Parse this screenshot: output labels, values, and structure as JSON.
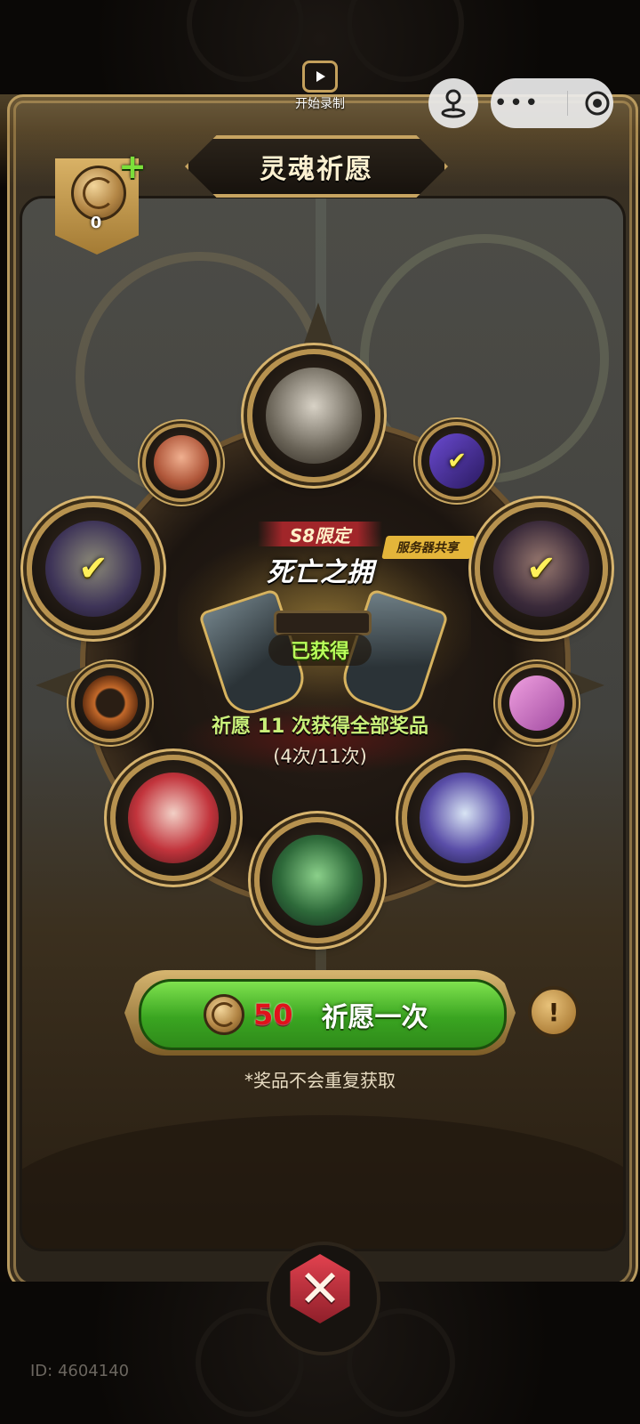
{
  "header": {
    "record_label": "开始录制",
    "title": "灵魂祈愿"
  },
  "currency": {
    "amount": "0",
    "add_icon": "plus-icon",
    "coin_icon": "soul-coin-icon"
  },
  "featured": {
    "season_tag": "S8限定",
    "name": "死亡之拥",
    "server_tag": "服务器共享",
    "status": "已获得"
  },
  "wish": {
    "info_text": "祈愿 11 次获得全部奖品",
    "progress": "(4次/11次)",
    "cost": "50",
    "button_label": "祈愿一次",
    "note": "*奖品不会重复获取",
    "info_button": "!"
  },
  "rewards": [
    {
      "slot": "top",
      "type": "hero-portrait",
      "obtained": false
    },
    {
      "slot": "top-left",
      "type": "item",
      "obtained": false
    },
    {
      "slot": "top-right",
      "type": "item",
      "obtained": true
    },
    {
      "slot": "left",
      "type": "hero-portrait",
      "obtained": true
    },
    {
      "slot": "right",
      "type": "hero-portrait",
      "obtained": true
    },
    {
      "slot": "mid-left",
      "type": "item",
      "obtained": false
    },
    {
      "slot": "mid-right",
      "type": "item",
      "obtained": false
    },
    {
      "slot": "bottom-left",
      "type": "hero-portrait",
      "obtained": false
    },
    {
      "slot": "bottom",
      "type": "hero-portrait",
      "obtained": false
    },
    {
      "slot": "bottom-right",
      "type": "hero-portrait",
      "obtained": false
    }
  ],
  "check_glyph": "✔",
  "close_glyph": "✕",
  "footer": {
    "user_id": "ID: 4604140"
  },
  "colors": {
    "accent_gold": "#c7a461",
    "wish_green": "#3aa521",
    "cost_red": "#e0121a",
    "obtained_green": "#b9ff5a"
  }
}
